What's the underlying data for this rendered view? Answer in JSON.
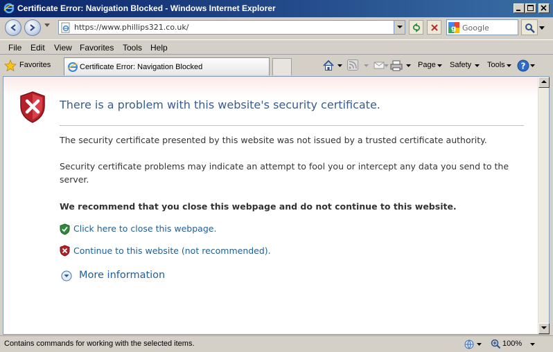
{
  "window": {
    "title": "Certificate Error: Navigation Blocked - Windows Internet Explorer"
  },
  "address_bar": {
    "url": "https://www.phillips321.co.uk/"
  },
  "search": {
    "placeholder": "Google"
  },
  "menu": {
    "items": [
      "File",
      "Edit",
      "View",
      "Favorites",
      "Tools",
      "Help"
    ]
  },
  "command_bar": {
    "favorites_label": "Favorites",
    "tab_label": "Certificate Error: Navigation Blocked",
    "page_label": "Page",
    "safety_label": "Safety",
    "tools_label": "Tools"
  },
  "content": {
    "heading": "There is a problem with this website's security certificate.",
    "paragraph1": "The security certificate presented by this website was not issued by a trusted certificate authority.",
    "paragraph2": "Security certificate problems may indicate an attempt to fool you or intercept any data you send to the server.",
    "recommendation": "We recommend that you close this webpage and do not continue to this website.",
    "close_link": "Click here to close this webpage.",
    "continue_link": "Continue to this website (not recommended).",
    "more_info": "More information"
  },
  "status_bar": {
    "text": "Contains commands for working with the selected items.",
    "zoom": "100%"
  },
  "colors": {
    "heading": "#3a5b8c",
    "link": "#1f5e9a",
    "titlebar_start": "#0a246a",
    "titlebar_end": "#3a6ea5"
  }
}
